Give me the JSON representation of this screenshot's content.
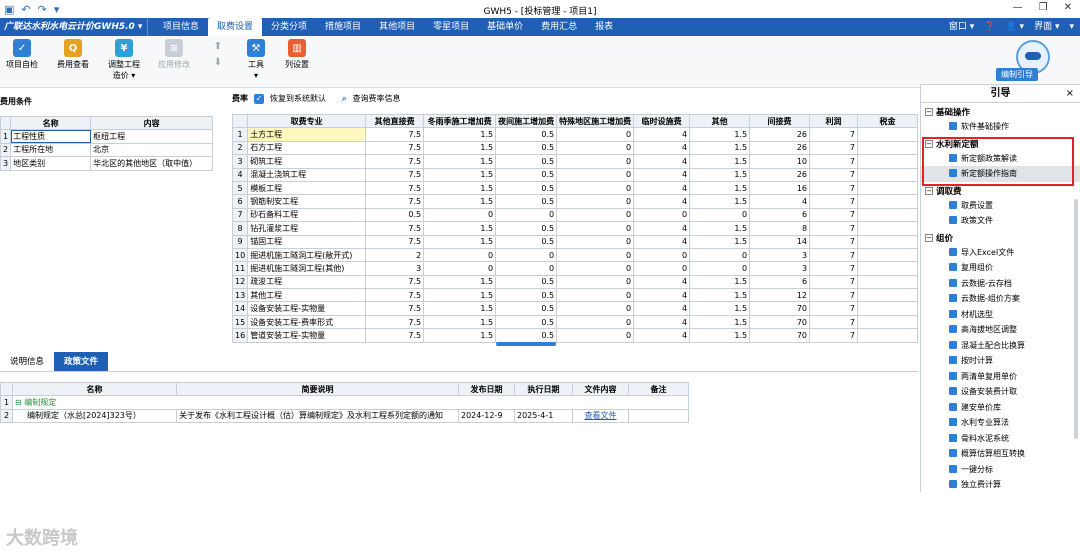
{
  "window": {
    "title": "GWH5 - [投标管理 - 项目1]"
  },
  "menubar": {
    "app_button": "广联达水利水电云计价GWH5.0 ▾",
    "tabs": [
      "项目信息",
      "取费设置",
      "分类分项",
      "措施项目",
      "其他项目",
      "零星项目",
      "基础单价",
      "费用汇总",
      "报表"
    ],
    "active_tab": 1,
    "right": [
      "窗口 ▾",
      "❓",
      "👤 ▾",
      "界面 ▾",
      "▾"
    ]
  },
  "ribbon": {
    "buttons": [
      "项目自检",
      "费用查看",
      "调整工程\n造价 ▾",
      "应用修改",
      "",
      "工具\n▾",
      "列设置"
    ],
    "guide_button": "编制引导"
  },
  "fee_conditions": {
    "section_label": "费用条件",
    "headers": [
      "名称",
      "内容"
    ],
    "rows": [
      {
        "n": "1",
        "name": "工程性质",
        "value": "枢纽工程"
      },
      {
        "n": "2",
        "name": "工程所在地",
        "value": "北京"
      },
      {
        "n": "3",
        "name": "地区类别",
        "value": "华北区的其他地区（取中值）"
      }
    ]
  },
  "rates": {
    "section_label": "费率",
    "restore_label": "恢复到系统默认",
    "query_label": "查询费率信息",
    "headers": [
      "取费专业",
      "其他直接费",
      "冬雨季施工增加费",
      "夜间施工增加费",
      "特殊地区施工增加费",
      "临时设施费",
      "其他",
      "间接费",
      "利润",
      "税金"
    ],
    "rows": [
      [
        "1",
        "土方工程",
        "7.5",
        "1.5",
        "0.5",
        "0",
        "4",
        "1.5",
        "26",
        "7",
        ""
      ],
      [
        "2",
        "石方工程",
        "7.5",
        "1.5",
        "0.5",
        "0",
        "4",
        "1.5",
        "26",
        "7",
        ""
      ],
      [
        "3",
        "砌筑工程",
        "7.5",
        "1.5",
        "0.5",
        "0",
        "4",
        "1.5",
        "10",
        "7",
        ""
      ],
      [
        "4",
        "混凝土浇筑工程",
        "7.5",
        "1.5",
        "0.5",
        "0",
        "4",
        "1.5",
        "26",
        "7",
        ""
      ],
      [
        "5",
        "模板工程",
        "7.5",
        "1.5",
        "0.5",
        "0",
        "4",
        "1.5",
        "16",
        "7",
        ""
      ],
      [
        "6",
        "钢筋制安工程",
        "7.5",
        "1.5",
        "0.5",
        "0",
        "4",
        "1.5",
        "4",
        "7",
        ""
      ],
      [
        "7",
        "砂石备料工程",
        "0.5",
        "0",
        "0",
        "0",
        "0",
        "0",
        "6",
        "7",
        ""
      ],
      [
        "8",
        "钻孔灌浆工程",
        "7.5",
        "1.5",
        "0.5",
        "0",
        "4",
        "1.5",
        "8",
        "7",
        ""
      ],
      [
        "9",
        "锚固工程",
        "7.5",
        "1.5",
        "0.5",
        "0",
        "4",
        "1.5",
        "14",
        "7",
        ""
      ],
      [
        "10",
        "掘进机施工隧洞工程(敞开式)",
        "2",
        "0",
        "0",
        "0",
        "0",
        "0",
        "3",
        "7",
        ""
      ],
      [
        "11",
        "掘进机施工隧洞工程(其他)",
        "3",
        "0",
        "0",
        "0",
        "0",
        "0",
        "3",
        "7",
        ""
      ],
      [
        "12",
        "疏浚工程",
        "7.5",
        "1.5",
        "0.5",
        "0",
        "4",
        "1.5",
        "6",
        "7",
        ""
      ],
      [
        "13",
        "其他工程",
        "7.5",
        "1.5",
        "0.5",
        "0",
        "4",
        "1.5",
        "12",
        "7",
        ""
      ],
      [
        "14",
        "设备安装工程-实物量",
        "7.5",
        "1.5",
        "0.5",
        "0",
        "4",
        "1.5",
        "70",
        "7",
        ""
      ],
      [
        "15",
        "设备安装工程-费率形式",
        "7.5",
        "1.5",
        "0.5",
        "0",
        "4",
        "1.5",
        "70",
        "7",
        ""
      ],
      [
        "16",
        "管道安装工程-实物量",
        "7.5",
        "1.5",
        "0.5",
        "0",
        "4",
        "1.5",
        "70",
        "7",
        ""
      ]
    ]
  },
  "bottom": {
    "tabs": [
      "说明信息",
      "政策文件"
    ],
    "active_tab": 1,
    "headers": [
      "名称",
      "简要说明",
      "发布日期",
      "执行日期",
      "文件内容",
      "备注"
    ],
    "group": {
      "n": "1",
      "name": "编制规定"
    },
    "rows": [
      {
        "n": "2",
        "name": "编制规定（水总[2024]323号）",
        "desc": "关于发布《水利工程设计概（估）算编制规定》及水利工程系列定额的通知",
        "pub": "2024-12-9",
        "exec": "2025-4-1",
        "link": "查看文件",
        "note": ""
      }
    ]
  },
  "guide": {
    "title": "引导",
    "close": "×",
    "groups": [
      {
        "label": "基础操作",
        "items": [
          "软件基础操作"
        ]
      },
      {
        "label": "水利新定额",
        "items": [
          "新定额政策解读",
          "新定额操作指南"
        ]
      },
      {
        "label": "调取费",
        "items": [
          "取费设置",
          "政策文件"
        ]
      },
      {
        "label": "组价",
        "items": [
          "导入Excel文件",
          "复用组价",
          "云数据-云存档",
          "云数据-组价方案",
          "材机选型",
          "高海拔地区调整",
          "混凝土配合比换算",
          "按时计算",
          "两清单复用单价",
          "设备安装费计取",
          "建安单价库",
          "水利专业算法",
          "骨料水泥系统",
          "概算估算相互转换",
          "一键分标",
          "独立费计算"
        ]
      }
    ],
    "selected_item": "新定额操作指南"
  },
  "watermark": "大数跨境"
}
